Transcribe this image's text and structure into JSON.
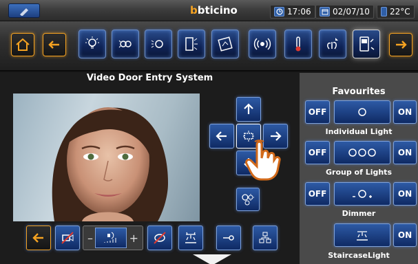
{
  "status": {
    "brand": "bticino",
    "time": "17:06",
    "date": "02/07/10",
    "temperature": "22°C"
  },
  "nav": {
    "icons": [
      "home-icon",
      "back-arrow-icon",
      "light-bulb-icon",
      "light-group-icon",
      "dimmer-icon",
      "scenario-icon",
      "energy-icon",
      "alarm-icon",
      "thermometer-icon",
      "garden-icon",
      "video-door-entry-icon",
      "forward-arrow-icon"
    ]
  },
  "main": {
    "title": "Video Door Entry System"
  },
  "favourites": {
    "title": "Favourites",
    "items": [
      {
        "off_label": "OFF",
        "on_label": "ON",
        "name": "Individual Light"
      },
      {
        "off_label": "OFF",
        "on_label": "ON",
        "name": "Group of Lights"
      },
      {
        "off_label": "OFF",
        "on_label": "ON",
        "name": "Dimmer"
      },
      {
        "on_label": "ON",
        "name": "StaircaseLight"
      }
    ]
  },
  "colors": {
    "accent_orange": "#f6a321",
    "button_blue": "#1d3f80",
    "panel_gray": "#4a4a4a"
  }
}
